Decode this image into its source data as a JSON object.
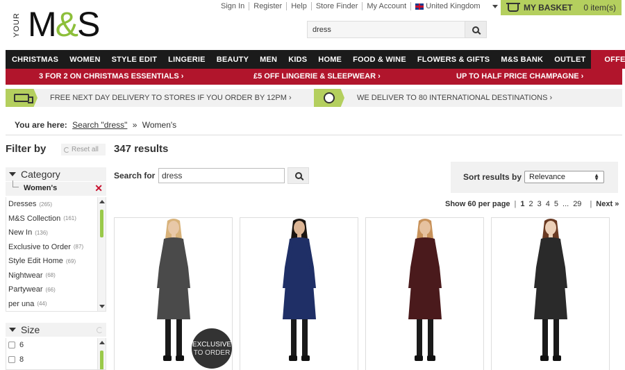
{
  "logo": {
    "your": "YOUR",
    "brand_m": "M",
    "brand_amp": "&",
    "brand_s": "S"
  },
  "toplinks": [
    "Sign In",
    "Register",
    "Help",
    "Store Finder",
    "My Account"
  ],
  "country": "United Kingdom",
  "basket": {
    "label": "MY BASKET",
    "count": "0 item(s)"
  },
  "search": {
    "value": "dress"
  },
  "nav": {
    "items": [
      "CHRISTMAS",
      "WOMEN",
      "STYLE EDIT",
      "LINGERIE",
      "BEAUTY",
      "MEN",
      "KIDS",
      "HOME",
      "FOOD & WINE",
      "FLOWERS & GIFTS",
      "M&S BANK",
      "OUTLET"
    ],
    "offers": "OFFERS"
  },
  "promos": [
    "3 FOR 2 ON CHRISTMAS ESSENTIALS  ›",
    "£5 OFF LINGERIE & SLEEPWEAR  ›",
    "UP TO HALF PRICE CHAMPAGNE  ›"
  ],
  "delivery": {
    "left": "FREE NEXT DAY DELIVERY TO STORES IF YOU ORDER BY 12PM  ›",
    "right": "WE DELIVER TO 80 INTERNATIONAL DESTINATIONS  ›"
  },
  "breadcrumb": {
    "label": "You are here:",
    "link": "Search \"dress\"",
    "sep": "»",
    "current": "Women's"
  },
  "filter": {
    "title": "Filter by",
    "reset": "Reset all",
    "category": {
      "title": "Category",
      "selected": "Women's",
      "remove": "✕",
      "items": [
        {
          "label": "Dresses",
          "count": "(265)"
        },
        {
          "label": "M&S Collection",
          "count": "(161)"
        },
        {
          "label": "New In",
          "count": "(136)"
        },
        {
          "label": "Exclusive to Order",
          "count": "(87)"
        },
        {
          "label": "Style Edit Home",
          "count": "(69)"
        },
        {
          "label": "Nightwear",
          "count": "(68)"
        },
        {
          "label": "Partywear",
          "count": "(66)"
        },
        {
          "label": "per una",
          "count": "(44)"
        }
      ]
    },
    "size": {
      "title": "Size",
      "items": [
        "6",
        "8"
      ]
    }
  },
  "results": {
    "count": "347 results",
    "search_for_label": "Search for",
    "search_for_value": "dress",
    "sort_label": "Sort results by",
    "sort_value": "Relevance",
    "per_page": "Show 60 per page",
    "pages": [
      "1",
      "2",
      "3",
      "4",
      "5",
      "...",
      "29"
    ],
    "next": "Next »"
  },
  "products": [
    {
      "dress_color": "#4a4a4a",
      "skin": "#e8c8a8",
      "hair": "#d8b27a",
      "badge": {
        "line1": "EXCLUSIVE",
        "line2": "TO ORDER"
      }
    },
    {
      "dress_color": "#1f2f66",
      "skin": "#dcb595",
      "hair": "#1a1410",
      "badge": null
    },
    {
      "dress_color": "#4a1a1c",
      "skin": "#e6c2a0",
      "hair": "#c8925a",
      "badge": null
    },
    {
      "dress_color": "#2a2a2a",
      "skin": "#ecd0b8",
      "hair": "#6a3a22",
      "badge": null
    }
  ]
}
